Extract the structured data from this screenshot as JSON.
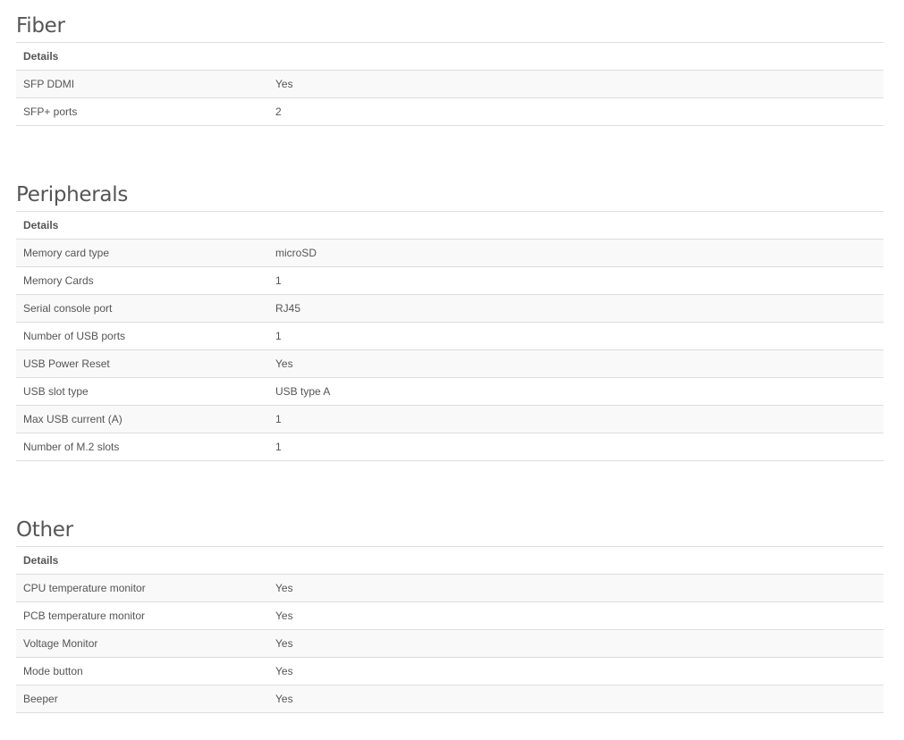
{
  "sections": {
    "fiber": {
      "title": "Fiber",
      "header": "Details",
      "rows": [
        {
          "label": "SFP DDMI",
          "value": "Yes"
        },
        {
          "label": "SFP+ ports",
          "value": "2"
        }
      ]
    },
    "peripherals": {
      "title": "Peripherals",
      "header": "Details",
      "rows": [
        {
          "label": "Memory card type",
          "value": "microSD"
        },
        {
          "label": "Memory Cards",
          "value": "1"
        },
        {
          "label": "Serial console port",
          "value": "RJ45"
        },
        {
          "label": "Number of USB ports",
          "value": "1"
        },
        {
          "label": "USB Power Reset",
          "value": "Yes"
        },
        {
          "label": "USB slot type",
          "value": "USB type A"
        },
        {
          "label": "Max USB current (A)",
          "value": "1"
        },
        {
          "label": "Number of M.2 slots",
          "value": "1"
        }
      ]
    },
    "other": {
      "title": "Other",
      "header": "Details",
      "rows": [
        {
          "label": "CPU temperature monitor",
          "value": "Yes"
        },
        {
          "label": "PCB temperature monitor",
          "value": "Yes"
        },
        {
          "label": "Voltage Monitor",
          "value": "Yes"
        },
        {
          "label": "Mode button",
          "value": "Yes"
        },
        {
          "label": "Beeper",
          "value": "Yes"
        }
      ]
    }
  }
}
